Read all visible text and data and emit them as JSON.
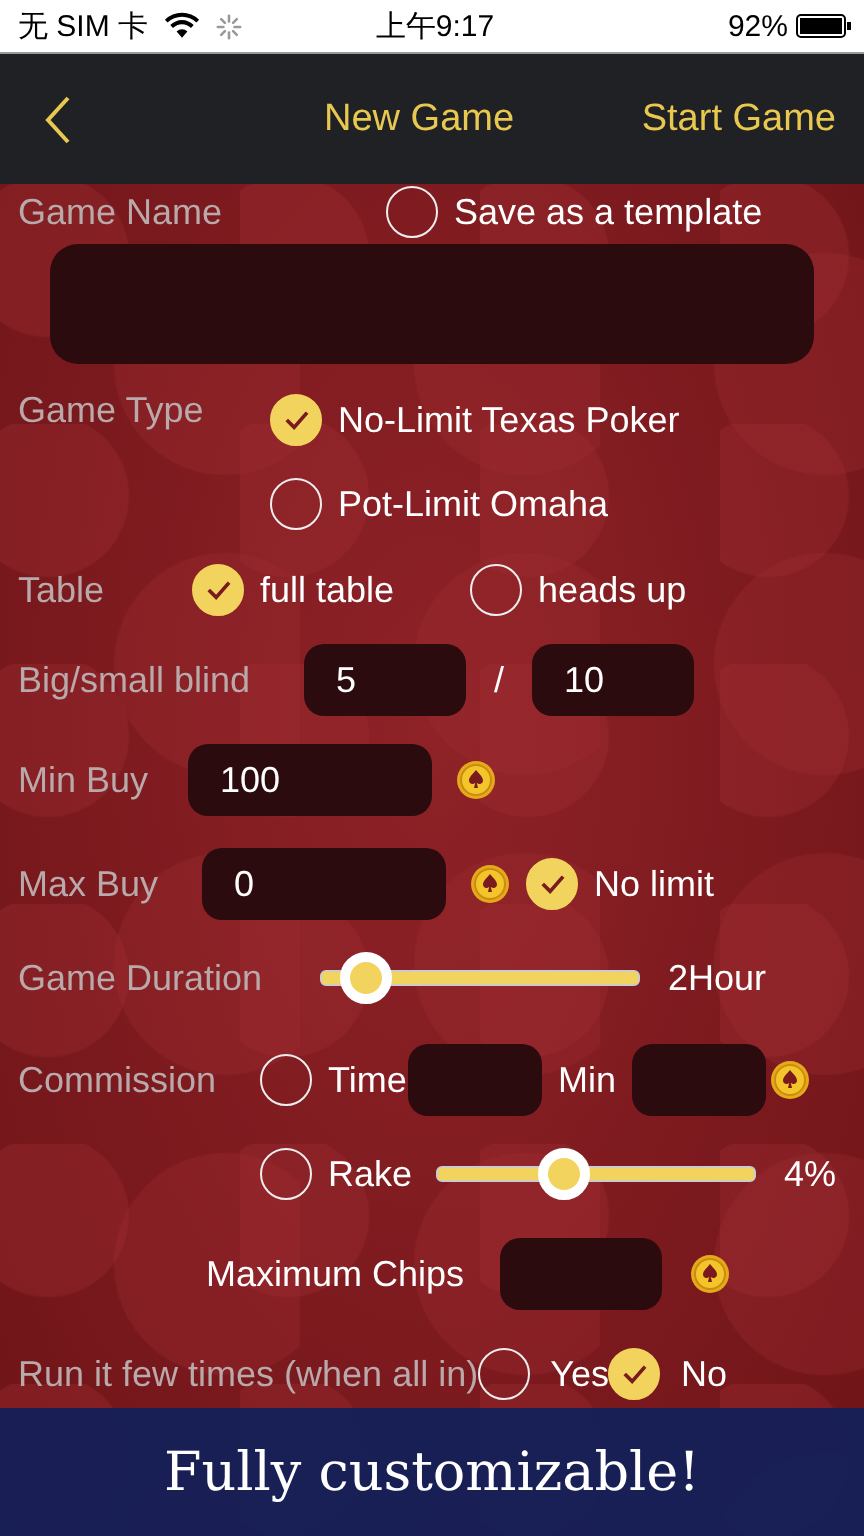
{
  "status_bar": {
    "carrier": "无 SIM 卡",
    "time": "上午9:17",
    "battery": "92%"
  },
  "nav": {
    "title": "New Game",
    "action": "Start Game"
  },
  "game_name": {
    "label": "Game Name",
    "save_template": {
      "label": "Save as a template",
      "checked": false
    }
  },
  "game_type": {
    "label": "Game Type",
    "options": [
      {
        "label": "No-Limit Texas Poker",
        "selected": true
      },
      {
        "label": "Pot-Limit Omaha",
        "selected": false
      }
    ]
  },
  "table": {
    "label": "Table",
    "options": [
      {
        "label": "full table",
        "selected": true
      },
      {
        "label": "heads up",
        "selected": false
      }
    ]
  },
  "blinds": {
    "label": "Big/small blind",
    "big": "5",
    "separator": "/",
    "small": "10"
  },
  "min_buy": {
    "label": "Min Buy",
    "value": "100"
  },
  "max_buy": {
    "label": "Max Buy",
    "value": "0",
    "no_limit": {
      "label": "No limit",
      "checked": true
    }
  },
  "duration": {
    "label": "Game Duration",
    "level": 0.14,
    "reading": "2Hour"
  },
  "commission": {
    "label": "Commission",
    "time": {
      "label": "Time",
      "selected": false,
      "unit": "Min"
    },
    "rake": {
      "label": "Rake",
      "selected": false,
      "level": 0.4,
      "reading": "4%"
    },
    "max_chips_label": "Maximum Chips"
  },
  "run_it": {
    "label": "Run it few times (when all in)",
    "options": [
      {
        "label": "Yes",
        "selected": false
      },
      {
        "label": "No",
        "selected": true
      }
    ]
  },
  "banner": {
    "text": "Fully customizable!"
  }
}
